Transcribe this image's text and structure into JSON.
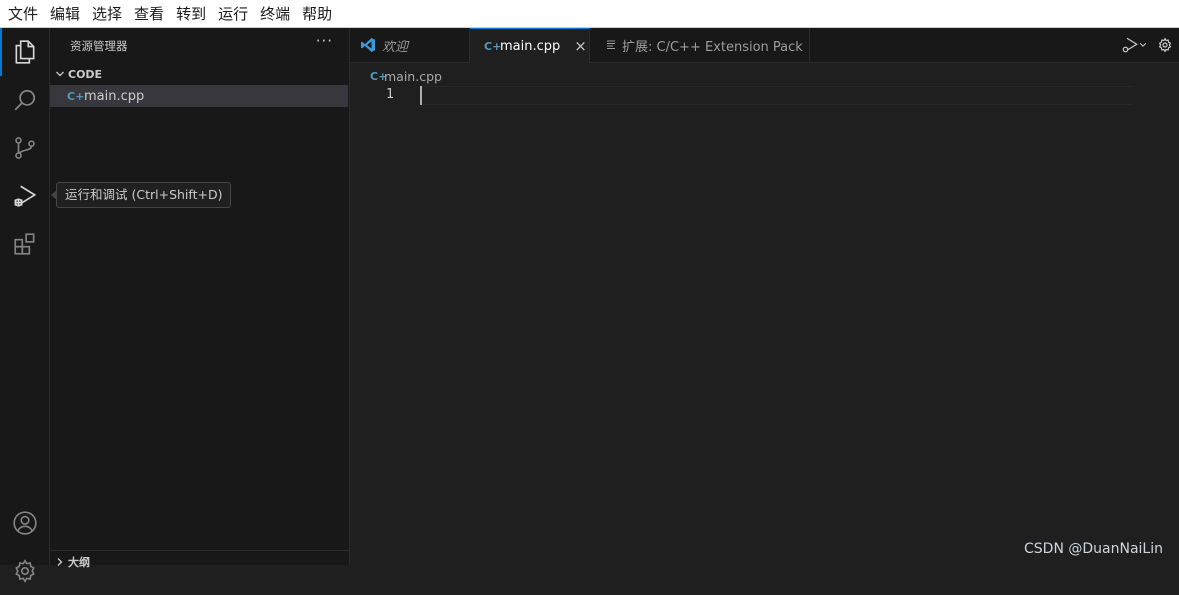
{
  "menubar": {
    "items": [
      {
        "label": "文件"
      },
      {
        "label": "编辑"
      },
      {
        "label": "选择"
      },
      {
        "label": "查看"
      },
      {
        "label": "转到"
      },
      {
        "label": "运行"
      },
      {
        "label": "终端"
      },
      {
        "label": "帮助"
      }
    ]
  },
  "activitybar": {
    "items": [
      {
        "name": "explorer",
        "icon": "files-icon",
        "active": true
      },
      {
        "name": "search",
        "icon": "search-icon"
      },
      {
        "name": "source-control",
        "icon": "source-control-icon"
      },
      {
        "name": "run-and-debug",
        "icon": "run-debug-icon"
      },
      {
        "name": "extensions",
        "icon": "extensions-icon"
      },
      {
        "name": "accounts",
        "icon": "account-icon"
      },
      {
        "name": "manage",
        "icon": "gear-icon"
      }
    ],
    "tooltip": "运行和调试 (Ctrl+Shift+D)"
  },
  "sidebar": {
    "title": "资源管理器",
    "more": "···",
    "section": "CODE",
    "files": [
      {
        "name": "main.cpp",
        "icon": "cpp-file-icon",
        "selected": true
      }
    ],
    "outline": "大纲"
  },
  "tabs": [
    {
      "label": "欢迎",
      "icon": "vscode-logo-icon",
      "active": false
    },
    {
      "label": "main.cpp",
      "icon": "cpp-file-icon",
      "active": true,
      "close": "×"
    },
    {
      "label": "扩展: C/C++ Extension Pack",
      "icon": "extension-pack-icon",
      "active": false
    }
  ],
  "editor": {
    "breadcrumb": "main.cpp",
    "line_numbers": [
      "1"
    ]
  },
  "watermark": "CSDN @DuanNaiLin",
  "colors": {
    "accent": "#0078d4",
    "cpp_icon": "#519aba",
    "vscode_blue": "#3c99d4"
  }
}
